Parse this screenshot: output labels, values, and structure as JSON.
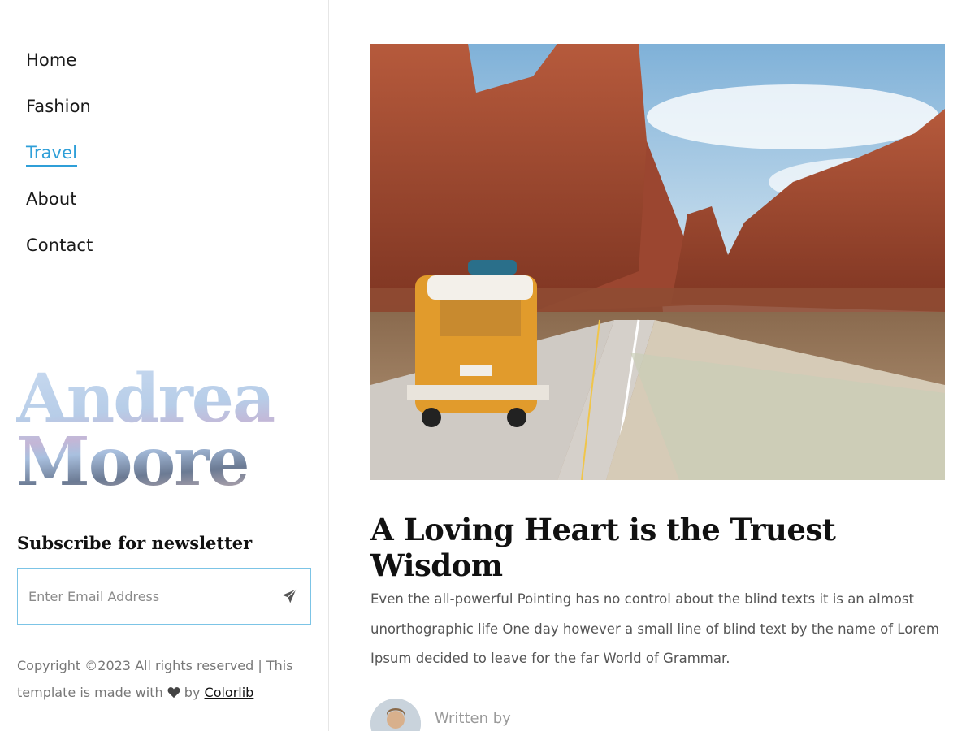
{
  "nav": {
    "items": [
      {
        "label": "Home"
      },
      {
        "label": "Fashion"
      },
      {
        "label": "Travel",
        "active": true
      },
      {
        "label": "About"
      },
      {
        "label": "Contact"
      }
    ]
  },
  "brand": {
    "line1": "Andrea",
    "line2": "Moore"
  },
  "subscribe": {
    "title": "Subscribe for newsletter",
    "placeholder": "Enter Email Address",
    "send_icon": "paper-plane-icon"
  },
  "footer": {
    "copyright_text": "Copyright ©2023 All rights reserved | This template is made with",
    "by_text": "by",
    "link_label": "Colorlib",
    "heart_icon": "heart-icon"
  },
  "post": {
    "title": "A Loving Heart is the Truest Wisdom",
    "excerpt": "Even the all-powerful Pointing has no control about the blind texts it is an almost unorthographic life One day however a small line of blind text by the name of Lorem Ipsum decided to leave for the far World of Grammar.",
    "written_by_label": "Written by"
  },
  "colors": {
    "accent": "#2f9fd8",
    "input_border": "#7cc4e6",
    "text_dark": "#111111",
    "text_muted": "#777777"
  }
}
